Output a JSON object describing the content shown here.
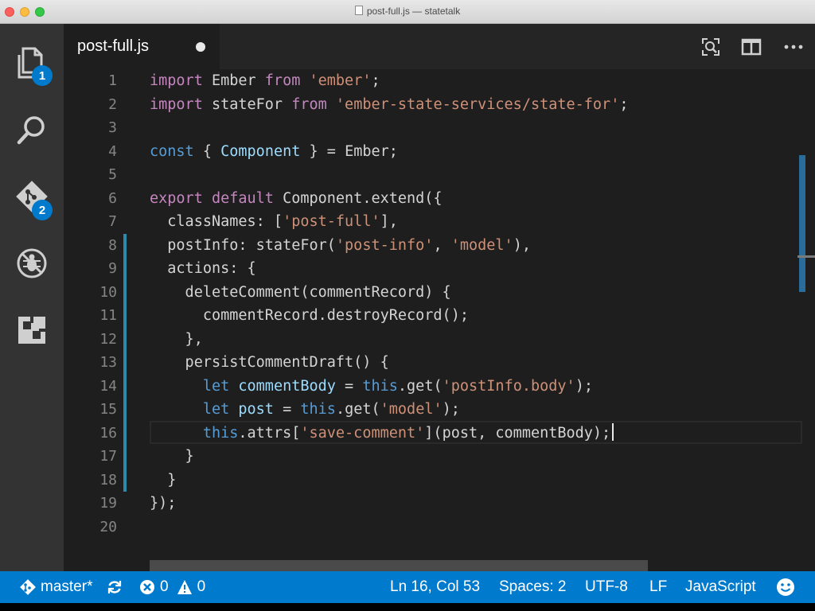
{
  "window": {
    "title": "post-full.js — statetalk"
  },
  "activity_bar": {
    "explorer_badge": "1",
    "scm_badge": "2"
  },
  "tab": {
    "title": "post-full.js"
  },
  "editor": {
    "line_numbers": [
      "1",
      "2",
      "3",
      "4",
      "5",
      "6",
      "7",
      "8",
      "9",
      "10",
      "11",
      "12",
      "13",
      "14",
      "15",
      "16",
      "17",
      "18",
      "19",
      "20"
    ],
    "code": {
      "l1": [
        "import",
        " Ember ",
        "from",
        " ",
        "'ember'",
        ";"
      ],
      "l2": [
        "import",
        " stateFor ",
        "from",
        " ",
        "'ember-state-services/state-for'",
        ";"
      ],
      "l4": [
        "const",
        " { ",
        "Component",
        " } = Ember;"
      ],
      "l6": [
        "export",
        " ",
        "default",
        " ",
        "Component",
        ".extend({"
      ],
      "l7": [
        "  classNames: [",
        "'post-full'",
        "],"
      ],
      "l8": [
        "  postInfo: stateFor(",
        "'post-info'",
        ", ",
        "'model'",
        "),"
      ],
      "l9": [
        "  actions: {"
      ],
      "l10": [
        "    deleteComment(commentRecord) {"
      ],
      "l11": [
        "      commentRecord.destroyRecord();"
      ],
      "l12": [
        "    },"
      ],
      "l13": [
        "    persistCommentDraft() {"
      ],
      "l14": [
        "      ",
        "let",
        " ",
        "commentBody",
        " = ",
        "this",
        ".get(",
        "'postInfo.body'",
        ");"
      ],
      "l15": [
        "      ",
        "let",
        " ",
        "post",
        " = ",
        "this",
        ".get(",
        "'model'",
        ");"
      ],
      "l16": [
        "      ",
        "this",
        ".attrs[",
        "'save-comment'",
        "](post, commentBody);"
      ],
      "l17": [
        "    }"
      ],
      "l18": [
        "  }"
      ],
      "l19": [
        "});"
      ]
    }
  },
  "status_bar": {
    "branch": "master*",
    "errors": "0",
    "warnings": "0",
    "position": "Ln 16, Col 53",
    "indent": "Spaces: 2",
    "encoding": "UTF-8",
    "eol": "LF",
    "language": "JavaScript"
  },
  "colors": {
    "status_bar": "#007acc",
    "editor_bg": "#1e1e1e",
    "activity_bar": "#333333",
    "keyword_blue": "#569cd6",
    "keyword_purple": "#c586c0",
    "string": "#ce9178"
  },
  "icons": [
    "files-icon",
    "search-icon",
    "git-icon",
    "debug-icon",
    "extensions-icon",
    "open-preview-icon",
    "split-editor-icon",
    "more-actions-icon",
    "git-branch-icon",
    "sync-icon",
    "error-icon",
    "warning-icon",
    "feedback-smiley-icon"
  ]
}
